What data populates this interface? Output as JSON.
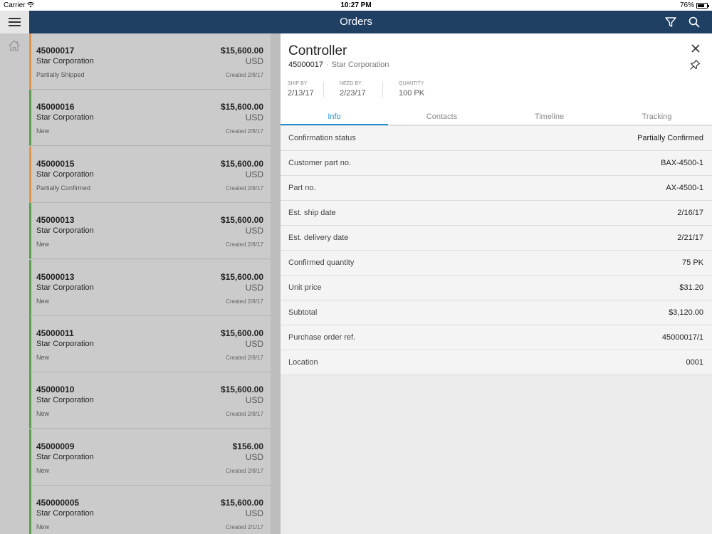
{
  "status_bar": {
    "carrier": "Carrier",
    "time": "10:27 PM",
    "battery": "76%",
    "battery_level": 0.76
  },
  "header": {
    "title": "Orders"
  },
  "orders": [
    {
      "number": "45000017",
      "customer": "Star Corporation",
      "status": "Partially Shipped",
      "amount": "$15,600.00",
      "currency": "USD",
      "created": "Created 2/8/17",
      "status_color": "#e2944a"
    },
    {
      "number": "45000016",
      "customer": "Star Corporation",
      "status": "New",
      "amount": "$15,600.00",
      "currency": "USD",
      "created": "Created 2/8/17",
      "status_color": "#5aa04e"
    },
    {
      "number": "45000015",
      "customer": "Star Corporation",
      "status": "Partially Confirmed",
      "amount": "$15,600.00",
      "currency": "USD",
      "created": "Created 2/8/17",
      "status_color": "#e2944a"
    },
    {
      "number": "45000013",
      "customer": "Star Corporation",
      "status": "New",
      "amount": "$15,600.00",
      "currency": "USD",
      "created": "Created 2/8/17",
      "status_color": "#5aa04e"
    },
    {
      "number": "45000013",
      "customer": "Star Corporation",
      "status": "New",
      "amount": "$15,600.00",
      "currency": "USD",
      "created": "Created 2/8/17",
      "status_color": "#5aa04e"
    },
    {
      "number": "45000011",
      "customer": "Star Corporation",
      "status": "New",
      "amount": "$15,600.00",
      "currency": "USD",
      "created": "Created 2/8/17",
      "status_color": "#5aa04e"
    },
    {
      "number": "45000010",
      "customer": "Star Corporation",
      "status": "New",
      "amount": "$15,600.00",
      "currency": "USD",
      "created": "Created 2/8/17",
      "status_color": "#5aa04e"
    },
    {
      "number": "45000009",
      "customer": "Star Corporation",
      "status": "New",
      "amount": "$156.00",
      "currency": "USD",
      "created": "Created 2/8/17",
      "status_color": "#5aa04e"
    },
    {
      "number": "450000005",
      "customer": "Star Corporation",
      "status": "New",
      "amount": "$15,600.00",
      "currency": "USD",
      "created": "Created 2/1/17",
      "status_color": "#5aa04e"
    }
  ],
  "detail": {
    "title": "Controller",
    "order_number": "45000017",
    "separator": "·",
    "customer": "Star Corporation",
    "ship_by_label": "SHIP BY",
    "ship_by": "2/13/17",
    "need_by_label": "NEED BY",
    "need_by": "2/23/17",
    "quantity_label": "QUANTITY",
    "quantity": "100 PK",
    "tabs": [
      "Info",
      "Contacts",
      "Timeline",
      "Tracking"
    ],
    "rows": [
      {
        "label": "Confirmation status",
        "value": "Partially Confirmed"
      },
      {
        "label": "Customer part no.",
        "value": "BAX-4500-1"
      },
      {
        "label": "Part no.",
        "value": "AX-4500-1"
      },
      {
        "label": "Est. ship date",
        "value": "2/16/17"
      },
      {
        "label": "Est. delivery date",
        "value": "2/21/17"
      },
      {
        "label": "Confirmed quantity",
        "value": "75 PK"
      },
      {
        "label": "Unit price",
        "value": "$31.20"
      },
      {
        "label": "Subtotal",
        "value": "$3,120.00"
      },
      {
        "label": "Purchase order ref.",
        "value": "45000017/1"
      },
      {
        "label": "Location",
        "value": "0001"
      }
    ]
  }
}
